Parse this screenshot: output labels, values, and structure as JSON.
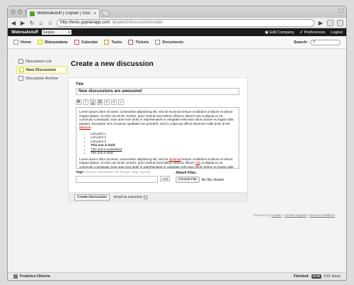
{
  "browser": {
    "tab_title": "Webreakstuff | Goplan | Disc",
    "url_host": "http://tests.goplanapp.com",
    "url_path": "/goplan2/discussion/create"
  },
  "appbar": {
    "brand": "Webreakstuff",
    "project": "Goplan",
    "edit_company": "Edit Company",
    "preferences": "Preferences",
    "logout": "Logout"
  },
  "nav": {
    "tabs": [
      {
        "label": "Home"
      },
      {
        "label": "Discussions"
      },
      {
        "label": "Calendar"
      },
      {
        "label": "Tasks"
      },
      {
        "label": "Tickets"
      },
      {
        "label": "Documents"
      }
    ],
    "search_label": "Search:"
  },
  "sidebar": {
    "items": [
      {
        "label": "Discussion List"
      },
      {
        "label": "New Discussion"
      },
      {
        "label": "Discussion Archive"
      }
    ]
  },
  "page": {
    "title": "Create a new discussion"
  },
  "form": {
    "title_label": "Title",
    "title_value": "New discussions are awesome!",
    "toolbar": [
      "B",
      "I",
      "U",
      "≡",
      "≡",
      "≡",
      "⌂"
    ],
    "para1_a": "Lorem ipsum dolor sit amet, consectetur adipisicing elit, sed do eiusmod tempor incididunt ut labore et dolore magna aliqua. Ut enim ad minim veniam, quis nostrud exercitation ullamco laboris nisi ut aliquip ex ea commodo consequat. Duis aute irure dolor in reprehenderit in voluptate velit esse cillum dolore eu fugiat nulla pariatur. Excepteur sint occaecat cupidatat non proident, sunt in culpa qui officia deserunt mollit anim id est ",
    "para1_b": "laborum",
    "list": [
      "List point 1",
      "List point 2",
      "List point 3",
      "This one is bold",
      "This one is underlined",
      "This one is italic"
    ],
    "para2_a": "Lorem ipsum dolor sit amet, consectetur adipisicing elit, sed do ",
    "para2_b": "eiusmod",
    "para2_c": " tempor incididunt ut labore et dolore magna aliqua. Ut enim ad minim veniam, quis nostrud exercitation ullamco laboris ",
    "para2_d": "nisi",
    "para2_e": " ut aliquip ex ea commodo consequat. Duis aute irure dolor in reprehenderit in voluptate velit esse cillum dolore eu fugiat nulla pariatur. Excepteur sint occaecat cupidatat non proident, sunt in culpa qui officia deserunt mollit anim id est laborum.",
    "tags_label": "Tags",
    "tags_hint": "(comma separated: 3D design, blog, layout)",
    "add_label": "Add",
    "attach_label": "Attach Files:",
    "choose_file": "Choose File",
    "no_file": "No file chosen",
    "create_button": "Create Discussion",
    "email_important": "Email as important"
  },
  "credits": {
    "prefix": "Powered by",
    "goplan": "Goplan",
    "sep1": "|",
    "contact": "Contact support",
    "sep2": "|",
    "feedback": "Send us feedback"
  },
  "statusbar": {
    "user": "Frederico Oliveira",
    "finished_label": "Finished:",
    "tests": "tests",
    "hours": "0.01 hours"
  }
}
